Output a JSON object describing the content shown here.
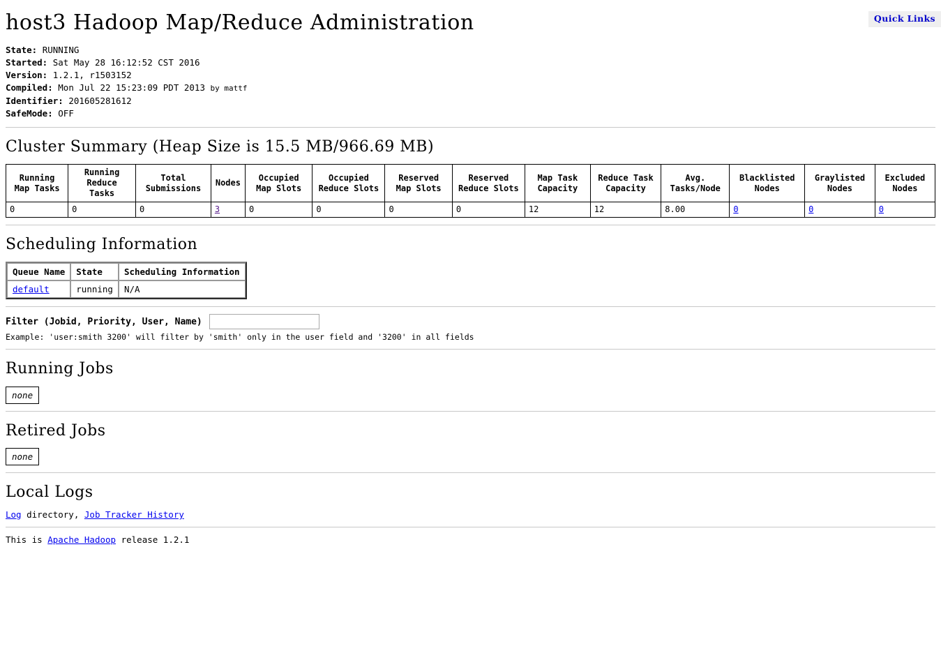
{
  "quick_links": {
    "label": "Quick Links"
  },
  "page_title": "host3 Hadoop Map/Reduce Administration",
  "status": {
    "state_label": "State:",
    "state_value": "RUNNING",
    "started_label": "Started:",
    "started_value": "Sat May 28 16:12:52 CST 2016",
    "version_label": "Version:",
    "version_value": "1.2.1, r1503152",
    "compiled_label": "Compiled:",
    "compiled_value": "Mon Jul 22 15:23:09 PDT 2013",
    "compiled_by": "by mattf",
    "identifier_label": "Identifier:",
    "identifier_value": "201605281612",
    "safemode_label": "SafeMode:",
    "safemode_value": "OFF"
  },
  "cluster_summary": {
    "title": "Cluster Summary (Heap Size is 15.5 MB/966.69 MB)",
    "headers": [
      "Running Map Tasks",
      "Running Reduce Tasks",
      "Total Submissions",
      "Nodes",
      "Occupied Map Slots",
      "Occupied Reduce Slots",
      "Reserved Map Slots",
      "Reserved Reduce Slots",
      "Map Task Capacity",
      "Reduce Task Capacity",
      "Avg. Tasks/Node",
      "Blacklisted Nodes",
      "Graylisted Nodes",
      "Excluded Nodes"
    ],
    "values": {
      "running_map_tasks": "0",
      "running_reduce_tasks": "0",
      "total_submissions": "0",
      "nodes": "3",
      "occupied_map_slots": "0",
      "occupied_reduce_slots": "0",
      "reserved_map_slots": "0",
      "reserved_reduce_slots": "0",
      "map_task_capacity": "12",
      "reduce_task_capacity": "12",
      "avg_tasks_per_node": "8.00",
      "blacklisted_nodes": "0",
      "graylisted_nodes": "0",
      "excluded_nodes": "0"
    }
  },
  "scheduling": {
    "title": "Scheduling Information",
    "headers": [
      "Queue Name",
      "State",
      "Scheduling Information"
    ],
    "row": {
      "queue_name": "default",
      "state": "running",
      "info": "N/A"
    }
  },
  "filter": {
    "label": "Filter (Jobid, Priority, User, Name)",
    "value": "",
    "placeholder": "",
    "example": "Example: 'user:smith 3200' will filter by 'smith' only in the user field and '3200' in all fields"
  },
  "running_jobs": {
    "title": "Running Jobs",
    "empty": "none"
  },
  "retired_jobs": {
    "title": "Retired Jobs",
    "empty": "none"
  },
  "local_logs": {
    "title": "Local Logs",
    "log_link": "Log",
    "directory_text": " directory, ",
    "history_link": "Job Tracker History"
  },
  "footer": {
    "prefix": "This is ",
    "apache_link": "Apache Hadoop",
    "suffix": " release 1.2.1"
  },
  "colors": {
    "link": "#0000ee",
    "visited_link": "#551a8b",
    "quicklinks_text": "#0000cc",
    "quicklinks_bg": "#efefef",
    "rule": "#c8c8c8"
  }
}
